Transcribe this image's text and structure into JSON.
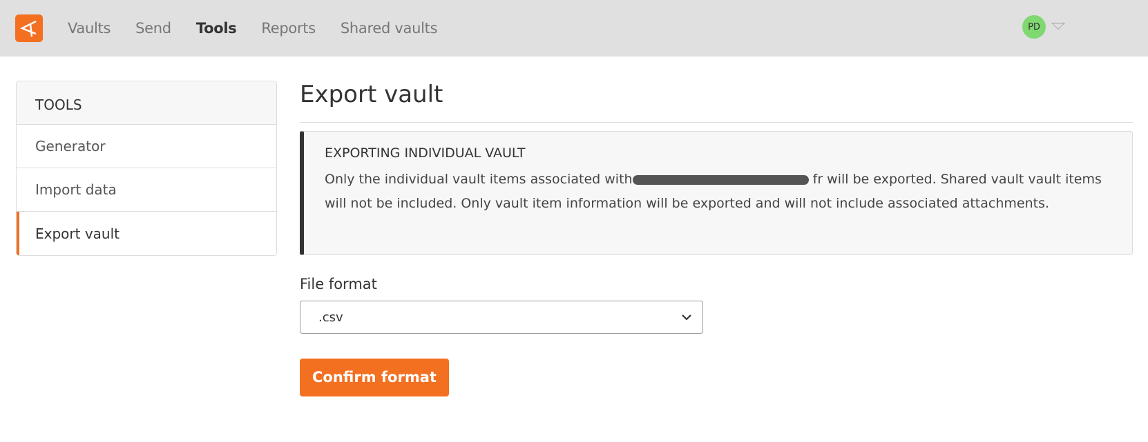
{
  "nav": {
    "items": [
      {
        "label": "Vaults"
      },
      {
        "label": "Send"
      },
      {
        "label": "Tools",
        "active": true
      },
      {
        "label": "Reports"
      },
      {
        "label": "Shared vaults"
      }
    ],
    "avatar": "PD",
    "brand_color": "#f37021",
    "avatar_color": "#7fd870"
  },
  "sidebar": {
    "title": "TOOLS",
    "items": [
      {
        "label": "Generator"
      },
      {
        "label": "Import data"
      },
      {
        "label": "Export vault",
        "active": true
      }
    ]
  },
  "main": {
    "title": "Export vault",
    "callout": {
      "title": "EXPORTING INDIVIDUAL VAULT",
      "text_before": "Only the individual vault items associated with",
      "text_after": "fr will be exported. Shared vault vault items will not be included. Only vault item information will be exported and will not include associated attachments."
    },
    "file_format_label": "File format",
    "file_format_value": ".csv",
    "confirm_label": "Confirm format"
  }
}
